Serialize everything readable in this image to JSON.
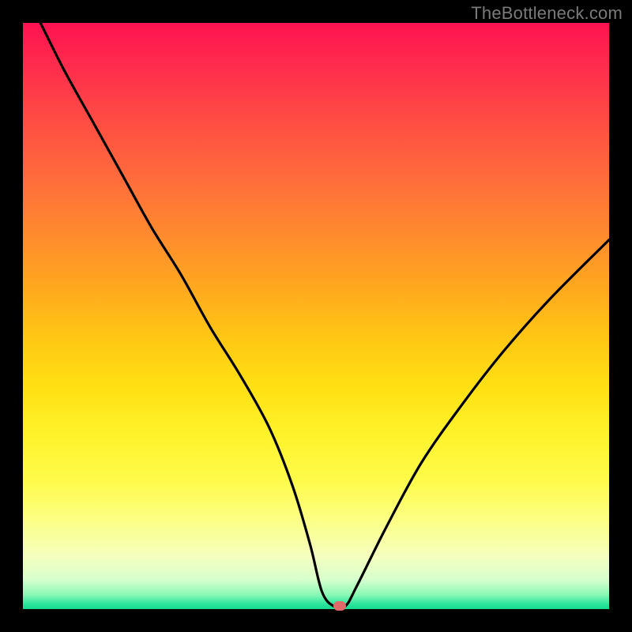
{
  "watermark": "TheBottleneck.com",
  "chart_data": {
    "type": "line",
    "title": "",
    "xlabel": "",
    "ylabel": "",
    "xlim": [
      0,
      100
    ],
    "ylim": [
      0,
      100
    ],
    "grid": false,
    "legend": false,
    "series": [
      {
        "name": "bottleneck-curve",
        "x": [
          3,
          7,
          12,
          17,
          22,
          27,
          32,
          37,
          42,
          46,
          49,
          51,
          53,
          55,
          57,
          62,
          68,
          75,
          82,
          90,
          100
        ],
        "y": [
          100,
          92,
          83,
          74,
          65,
          57,
          48,
          40,
          31,
          21,
          11,
          3,
          0.5,
          0.5,
          4,
          14,
          25,
          35,
          44,
          53,
          63
        ]
      }
    ],
    "marker": {
      "x": 54,
      "y": 0.5,
      "color": "#e06a6a"
    },
    "gradient_stops": [
      {
        "pct": 0,
        "color": "#ff1351"
      },
      {
        "pct": 50,
        "color": "#ffc814"
      },
      {
        "pct": 90,
        "color": "#f4ffbf"
      },
      {
        "pct": 100,
        "color": "#14d88f"
      }
    ]
  }
}
